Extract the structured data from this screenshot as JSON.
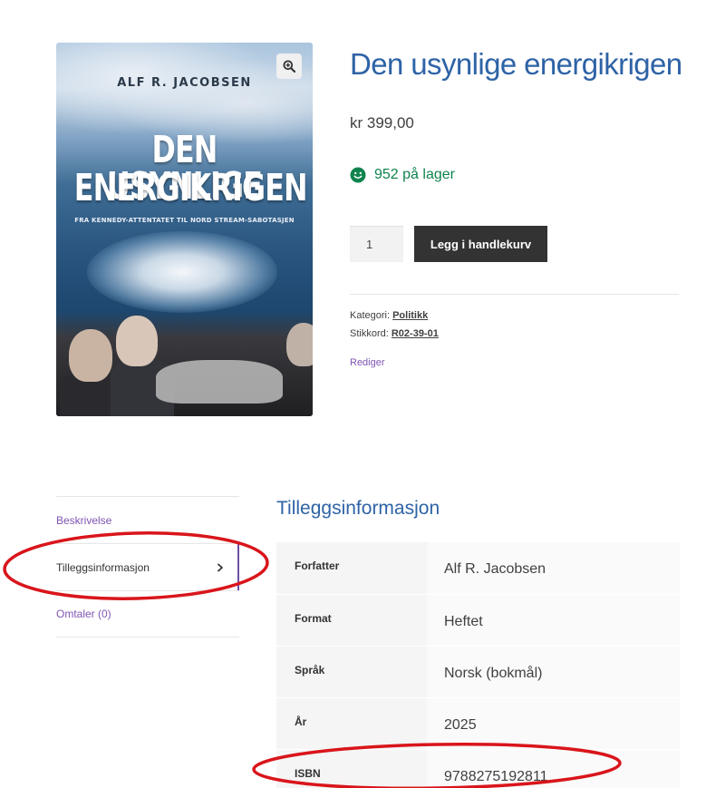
{
  "product": {
    "title": "Den usynlige energikrigen",
    "price": "kr 399,00",
    "stock": "952 på lager",
    "quantity": "1",
    "add_to_cart_label": "Legg i handlekurv"
  },
  "cover": {
    "author": "ALF R. JACOBSEN",
    "title_line1": "DEN USYNLIGE",
    "title_line2": "ENERGIKRIGEN",
    "subtitle": "FRA KENNEDY-ATTENTATET TIL NORD STREAM-SABOTASJEN"
  },
  "meta": {
    "category_label": "Kategori:",
    "category_value": "Politikk",
    "tag_label": "Stikkord:",
    "tag_value": "R02-39-01",
    "edit_label": "Rediger"
  },
  "tabs": [
    {
      "label": "Beskrivelse",
      "active": false
    },
    {
      "label": "Tilleggsinformasjon",
      "active": true
    },
    {
      "label": "Omtaler (0)",
      "active": false
    }
  ],
  "additional_info": {
    "title": "Tilleggsinformasjon",
    "rows": [
      {
        "label": "Forfatter",
        "value": "Alf R. Jacobsen"
      },
      {
        "label": "Format",
        "value": "Heftet"
      },
      {
        "label": "Språk",
        "value": "Norsk (bokmål)"
      },
      {
        "label": "År",
        "value": "2025"
      },
      {
        "label": "ISBN",
        "value": "9788275192811"
      }
    ]
  },
  "colors": {
    "title_blue": "#2e63a6",
    "link_purple": "#7f54b3",
    "stock_green": "#0f834d",
    "button_dark": "#333333",
    "annotation_red": "#d9151b"
  },
  "icons": {
    "zoom": "magnifier-plus-icon",
    "stock": "smiley-icon",
    "tab_arrow": "chevron-right-icon"
  }
}
